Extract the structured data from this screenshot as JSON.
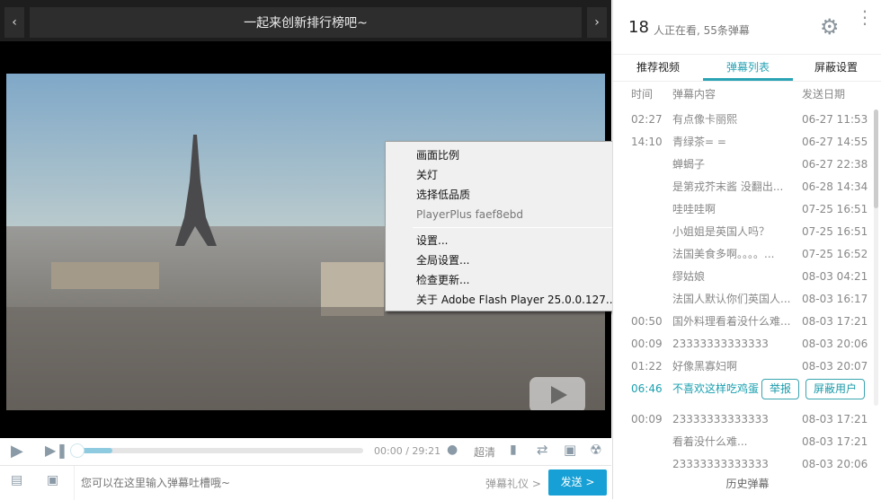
{
  "player": {
    "title": "一起来创新排行榜吧~",
    "prev_icon": "chevron-left-icon",
    "next_icon": "chevron-right-icon",
    "time": "00:00 / 29:21",
    "progress_fraction": 0.0,
    "buffer_fraction": 0.1,
    "quality": "超清",
    "input_placeholder": "您可以在这里输入弹幕吐槽哦~",
    "etiquette": "弹幕礼仪 >",
    "send": "发送 >"
  },
  "context_menu": {
    "items": [
      "画面比例",
      "关灯",
      "选择低品质",
      "PlayerPlus faef8ebd",
      "设置...",
      "全局设置...",
      "检查更新...",
      "关于 Adobe Flash Player 25.0.0.127..."
    ],
    "submenu_arrow": ">"
  },
  "panel": {
    "viewers": "18",
    "status": "人正在看, 55条弹幕",
    "tabs": [
      "推荐视频",
      "弹幕列表",
      "屏蔽设置"
    ],
    "active_tab": 1,
    "headers": [
      "时间",
      "弹幕内容",
      "发送日期"
    ],
    "rows": [
      [
        "02:27",
        "有点像卡丽熙",
        "06-27 11:53"
      ],
      [
        "14:10",
        "青绿茶= =",
        "06-27 14:55"
      ],
      [
        "",
        "蝉蝎子",
        "06-27 22:38"
      ],
      [
        "",
        "是第戎芥末酱  没翻出...",
        "06-28 14:34"
      ],
      [
        "",
        "哇哇哇啊",
        "07-25 16:51"
      ],
      [
        "",
        "小姐姐是英国人吗？",
        "07-25 16:51"
      ],
      [
        "",
        "法国美食多啊。。。。...",
        "07-25 16:52"
      ],
      [
        "",
        "缪姑娘",
        "08-03 04:21"
      ],
      [
        "",
        "法国人默认你们英国人...",
        "08-03 16:17"
      ],
      [
        "00:50",
        "国外料理看着没什么难...",
        "08-03 17:21"
      ],
      [
        "00:09",
        "23333333333333",
        "08-03 20:06"
      ],
      [
        "01:22",
        "好像黑寡妇啊",
        "08-03 20:07"
      ]
    ],
    "highlight_row": [
      "06:46",
      "不喜欢这样吃鸡蛋"
    ],
    "report": "举报",
    "block_user": "屏蔽用户",
    "extra_rows": [
      [
        "00:09",
        "23333333333333",
        "08-03 17:21"
      ],
      [
        "",
        "看着没什么难...",
        "08-03 17:21"
      ],
      [
        "",
        "23333333333333",
        "08-03 20:06"
      ]
    ],
    "history": "历史弹幕",
    "accent": "#2aa3b5"
  }
}
